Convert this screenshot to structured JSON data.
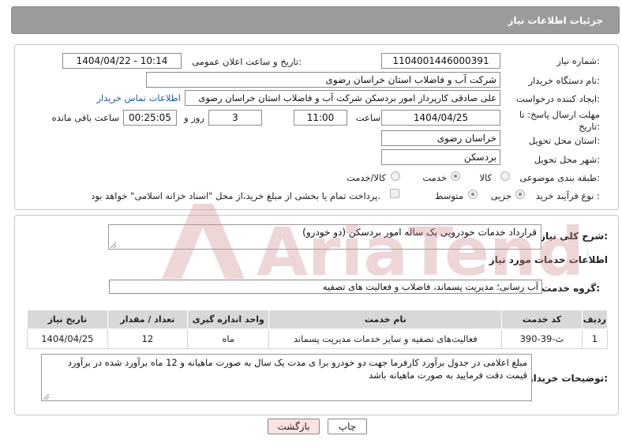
{
  "header": {
    "title": "جزئیات اطلاعات نیاز"
  },
  "form": {
    "need_number_label": "شماره نیاز:",
    "need_number": "1104001446000391",
    "announce_label": "تاریخ و ساعت اعلان عمومی:",
    "announce_value": "1404/04/22 - 10:14",
    "buyer_org_label": "نام دستگاه خریدار:",
    "buyer_org": "شرکت آب و فاضلاب استان خراسان رضوی",
    "requester_label": "ایجاد کننده درخواست:",
    "requester": "علی صادقی کارپرداز امور بردسکن  شرکت آب و فاضلاب استان خراسان رضوی",
    "contact_link": "اطلاعات تماس خریدار",
    "deadline_label_1": "مهلت ارسال پاسخ: تا",
    "deadline_label_2": "تاریخ:",
    "deadline_date": "1404/04/25",
    "time_label": "ساعت",
    "deadline_time": "11:00",
    "days_value": "3",
    "days_label": "روز و",
    "remaining_time": "00:25:05",
    "remaining_label": "ساعت باقی مانده",
    "province_label": "استان محل تحویل:",
    "province": "خراسان رضوی",
    "city_label": "شهر محل تحویل:",
    "city": "بردسکن",
    "category_label": "طبقه بندی موضوعی:",
    "category_options": [
      "کالا",
      "خدمت",
      "کالا/خدمت"
    ],
    "category_selected": "خدمت",
    "process_label": "نوع فرآیند خرید :",
    "process_options": [
      "جزیی",
      "متوسط"
    ],
    "process_selected": "جزیی",
    "payment_note": "پرداخت تمام یا بخشی از مبلغ خرید،از محل \"اسناد خزانه اسلامی\" خواهد بود."
  },
  "description": {
    "label": "شرح کلی نیاز:",
    "value": "قرارداد خدمات خودرویی یک ساله امور بردسکن (دو خودرو)"
  },
  "services": {
    "section_title": "اطلاعات خدمات مورد نیاز",
    "group_label": "گروه خدمت:",
    "group_value": "آب رسانی؛ مدیریت پسماند، فاضلاب و فعالیت های تصفیه",
    "columns": [
      "ردیف",
      "کد خدمت",
      "نام خدمت",
      "واحد اندازه گیری",
      "تعداد / مقدار",
      "تاریخ نیاز"
    ],
    "rows": [
      [
        "1",
        "ث-39-390",
        "فعالیت‌های تصفیه و سایر خدمات مدیریت پسماند",
        "ماه",
        "12",
        "1404/04/25"
      ]
    ]
  },
  "buyer_notes": {
    "label": "توضیحات خریدار:",
    "value": "مبلغ اعلامی در جدول برآورد کارفرما جهت دو خودرو برا ی مدت یک سال به صورت ماهیانه و 12 ماه برآورد شده در برآورد قیمت دقت فرمایید به صورت ماهیانه باشد"
  },
  "buttons": {
    "print": "چاپ",
    "back": "بازگشت"
  },
  "watermark": {
    "text": "AriaTender.net"
  },
  "colors": {
    "header_bg": "#9b9b9b",
    "link": "#1a5fb4",
    "back_button_bg": "#fde2e2",
    "watermark": "#e7b8b8"
  }
}
